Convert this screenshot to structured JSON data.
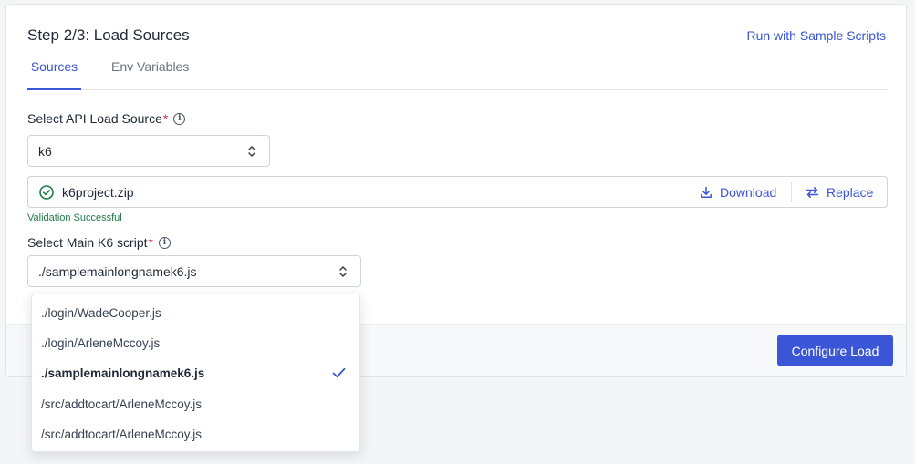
{
  "header": {
    "title": "Step 2/3: Load Sources",
    "sample_link": "Run with Sample Scripts"
  },
  "tabs": [
    {
      "label": "Sources",
      "active": true
    },
    {
      "label": "Env Variables",
      "active": false
    }
  ],
  "load_source": {
    "label": "Select API Load Source",
    "required_mark": "*",
    "value": "k6"
  },
  "file": {
    "name": "k6project.zip",
    "status_icon": "check-circle-icon",
    "download_label": "Download",
    "replace_label": "Replace",
    "validation": "Validation Successful"
  },
  "main_script": {
    "label": "Select Main K6 script",
    "required_mark": "*",
    "value": "./samplemainlongnamek6.js",
    "options": [
      {
        "label": "./login/WadeCooper.js",
        "selected": false
      },
      {
        "label": "./login/ArleneMccoy.js",
        "selected": false
      },
      {
        "label": "./samplemainlongnamek6.js",
        "selected": true
      },
      {
        "label": "/src/addtocart/ArleneMccoy.js",
        "selected": false
      },
      {
        "label": "/src/addtocart/ArleneMccoy.js",
        "selected": false
      }
    ]
  },
  "footer": {
    "configure_label": "Configure Load"
  },
  "colors": {
    "accent": "#3a55d6",
    "success": "#1e7b4b",
    "required": "#d9363e"
  }
}
